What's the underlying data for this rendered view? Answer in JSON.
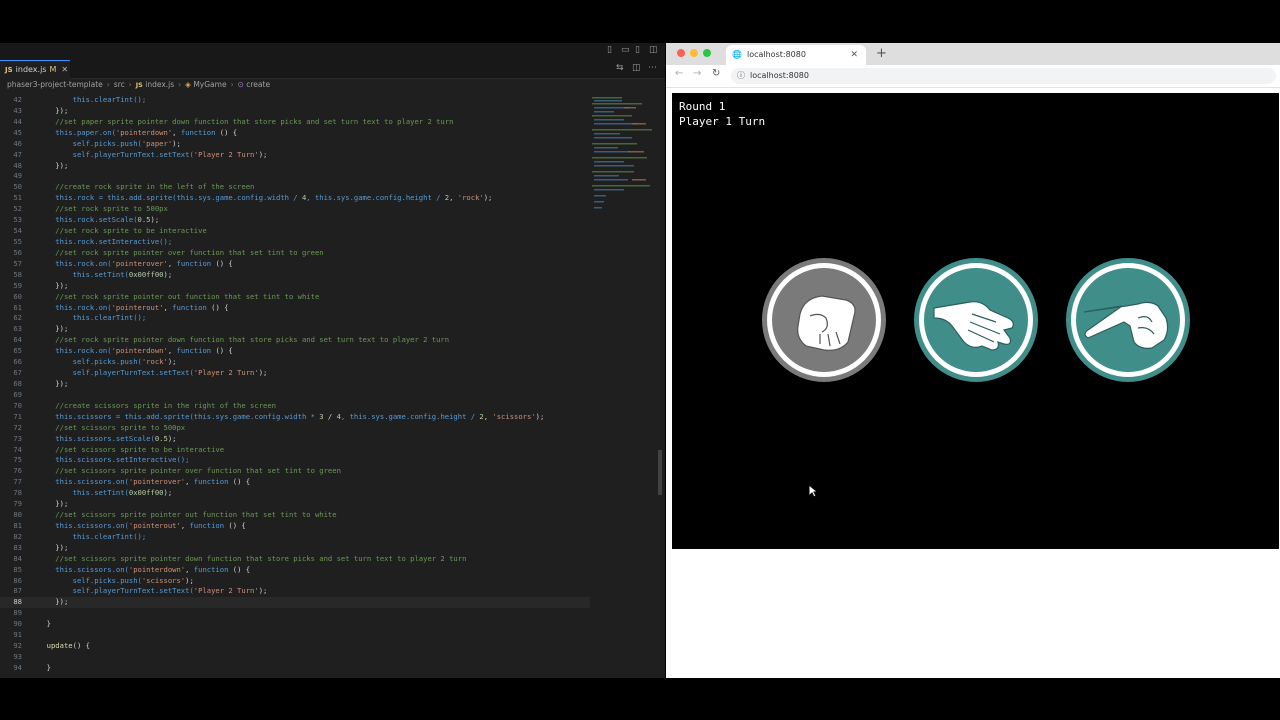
{
  "editor": {
    "tab": {
      "lang": "JS",
      "name": "index.js",
      "status": "M"
    },
    "breadcrumbs": [
      "phaser3-project-template",
      "src",
      "JS",
      "index.js",
      "MyGame",
      "create"
    ],
    "lines": [
      {
        "n": "42",
        "segs": [
          {
            "t": "        this.clearTint();",
            "c": "k"
          }
        ]
      },
      {
        "n": "43",
        "segs": [
          {
            "t": "    });",
            "c": "p"
          }
        ]
      },
      {
        "n": "44",
        "segs": [
          {
            "t": "    //set paper sprite pointer down function that store picks and set turn text to player 2 turn",
            "c": "c"
          }
        ]
      },
      {
        "n": "45",
        "segs": [
          {
            "t": "    this.paper.on(",
            "c": "k"
          },
          {
            "t": "'pointerdown'",
            "c": "s"
          },
          {
            "t": ", ",
            "c": "p"
          },
          {
            "t": "function",
            "c": "k"
          },
          {
            "t": " () {",
            "c": "p"
          }
        ]
      },
      {
        "n": "46",
        "segs": [
          {
            "t": "        self.picks.push(",
            "c": "k"
          },
          {
            "t": "'paper'",
            "c": "s"
          },
          {
            "t": ");",
            "c": "p"
          }
        ]
      },
      {
        "n": "47",
        "segs": [
          {
            "t": "        self.playerTurnText.setText(",
            "c": "k"
          },
          {
            "t": "'Player 2 Turn'",
            "c": "s"
          },
          {
            "t": ");",
            "c": "p"
          }
        ]
      },
      {
        "n": "48",
        "segs": [
          {
            "t": "    });",
            "c": "p"
          }
        ]
      },
      {
        "n": "49",
        "segs": []
      },
      {
        "n": "50",
        "segs": [
          {
            "t": "    //create rock sprite in the left of the screen",
            "c": "c"
          }
        ]
      },
      {
        "n": "51",
        "segs": [
          {
            "t": "    this.rock = this.add.sprite(this.sys.game.config.width / ",
            "c": "k"
          },
          {
            "t": "4",
            "c": "n"
          },
          {
            "t": ", this.sys.game.config.height / ",
            "c": "k"
          },
          {
            "t": "2",
            "c": "n"
          },
          {
            "t": ", ",
            "c": "p"
          },
          {
            "t": "'rock'",
            "c": "s"
          },
          {
            "t": ");",
            "c": "p"
          }
        ]
      },
      {
        "n": "52",
        "segs": [
          {
            "t": "    //set rock sprite to 500px",
            "c": "c"
          }
        ]
      },
      {
        "n": "53",
        "segs": [
          {
            "t": "    this.rock.setScale(",
            "c": "k"
          },
          {
            "t": "0.5",
            "c": "n"
          },
          {
            "t": ");",
            "c": "p"
          }
        ]
      },
      {
        "n": "54",
        "segs": [
          {
            "t": "    //set rock sprite to be interactive",
            "c": "c"
          }
        ]
      },
      {
        "n": "55",
        "segs": [
          {
            "t": "    this.rock.setInteractive();",
            "c": "k"
          }
        ]
      },
      {
        "n": "56",
        "segs": [
          {
            "t": "    //set rock sprite pointer over function that set tint to green",
            "c": "c"
          }
        ]
      },
      {
        "n": "57",
        "segs": [
          {
            "t": "    this.rock.on(",
            "c": "k"
          },
          {
            "t": "'pointerover'",
            "c": "s"
          },
          {
            "t": ", ",
            "c": "p"
          },
          {
            "t": "function",
            "c": "k"
          },
          {
            "t": " () {",
            "c": "p"
          }
        ]
      },
      {
        "n": "58",
        "segs": [
          {
            "t": "        this.setTint(",
            "c": "k"
          },
          {
            "t": "0x00ff00",
            "c": "n"
          },
          {
            "t": ");",
            "c": "p"
          }
        ]
      },
      {
        "n": "59",
        "segs": [
          {
            "t": "    });",
            "c": "p"
          }
        ]
      },
      {
        "n": "60",
        "segs": [
          {
            "t": "    //set rock sprite pointer out function that set tint to white",
            "c": "c"
          }
        ]
      },
      {
        "n": "61",
        "segs": [
          {
            "t": "    this.rock.on(",
            "c": "k"
          },
          {
            "t": "'pointerout'",
            "c": "s"
          },
          {
            "t": ", ",
            "c": "p"
          },
          {
            "t": "function",
            "c": "k"
          },
          {
            "t": " () {",
            "c": "p"
          }
        ]
      },
      {
        "n": "62",
        "segs": [
          {
            "t": "        this.clearTint();",
            "c": "k"
          }
        ]
      },
      {
        "n": "63",
        "segs": [
          {
            "t": "    });",
            "c": "p"
          }
        ]
      },
      {
        "n": "64",
        "segs": [
          {
            "t": "    //set rock sprite pointer down function that store picks and set turn text to player 2 turn",
            "c": "c"
          }
        ]
      },
      {
        "n": "65",
        "segs": [
          {
            "t": "    this.rock.on(",
            "c": "k"
          },
          {
            "t": "'pointerdown'",
            "c": "s"
          },
          {
            "t": ", ",
            "c": "p"
          },
          {
            "t": "function",
            "c": "k"
          },
          {
            "t": " () {",
            "c": "p"
          }
        ]
      },
      {
        "n": "66",
        "segs": [
          {
            "t": "        self.picks.push(",
            "c": "k"
          },
          {
            "t": "'rock'",
            "c": "s"
          },
          {
            "t": ");",
            "c": "p"
          }
        ]
      },
      {
        "n": "67",
        "segs": [
          {
            "t": "        self.playerTurnText.setText(",
            "c": "k"
          },
          {
            "t": "'Player 2 Turn'",
            "c": "s"
          },
          {
            "t": ");",
            "c": "p"
          }
        ]
      },
      {
        "n": "68",
        "segs": [
          {
            "t": "    });",
            "c": "p"
          }
        ]
      },
      {
        "n": "69",
        "segs": []
      },
      {
        "n": "70",
        "segs": [
          {
            "t": "    //create scissors sprite in the right of the screen",
            "c": "c"
          }
        ]
      },
      {
        "n": "71",
        "segs": [
          {
            "t": "    this.scissors = this.add.sprite(this.sys.game.config.width * ",
            "c": "k"
          },
          {
            "t": "3",
            "c": "n"
          },
          {
            "t": " / ",
            "c": "p"
          },
          {
            "t": "4",
            "c": "n"
          },
          {
            "t": ", this.sys.game.config.height / ",
            "c": "k"
          },
          {
            "t": "2",
            "c": "n"
          },
          {
            "t": ", ",
            "c": "p"
          },
          {
            "t": "'scissors'",
            "c": "s"
          },
          {
            "t": ");",
            "c": "p"
          }
        ]
      },
      {
        "n": "72",
        "segs": [
          {
            "t": "    //set scissors sprite to 500px",
            "c": "c"
          }
        ]
      },
      {
        "n": "73",
        "segs": [
          {
            "t": "    this.scissors.setScale(",
            "c": "k"
          },
          {
            "t": "0.5",
            "c": "n"
          },
          {
            "t": ");",
            "c": "p"
          }
        ]
      },
      {
        "n": "74",
        "segs": [
          {
            "t": "    //set scissors sprite to be interactive",
            "c": "c"
          }
        ]
      },
      {
        "n": "75",
        "segs": [
          {
            "t": "    this.scissors.setInteractive();",
            "c": "k"
          }
        ]
      },
      {
        "n": "76",
        "segs": [
          {
            "t": "    //set scissors sprite pointer over function that set tint to green",
            "c": "c"
          }
        ]
      },
      {
        "n": "77",
        "segs": [
          {
            "t": "    this.scissors.on(",
            "c": "k"
          },
          {
            "t": "'pointerover'",
            "c": "s"
          },
          {
            "t": ", ",
            "c": "p"
          },
          {
            "t": "function",
            "c": "k"
          },
          {
            "t": " () {",
            "c": "p"
          }
        ]
      },
      {
        "n": "78",
        "segs": [
          {
            "t": "        this.setTint(",
            "c": "k"
          },
          {
            "t": "0x00ff00",
            "c": "n"
          },
          {
            "t": ");",
            "c": "p"
          }
        ]
      },
      {
        "n": "79",
        "segs": [
          {
            "t": "    });",
            "c": "p"
          }
        ]
      },
      {
        "n": "80",
        "segs": [
          {
            "t": "    //set scissors sprite pointer out function that set tint to white",
            "c": "c"
          }
        ]
      },
      {
        "n": "81",
        "segs": [
          {
            "t": "    this.scissors.on(",
            "c": "k"
          },
          {
            "t": "'pointerout'",
            "c": "s"
          },
          {
            "t": ", ",
            "c": "p"
          },
          {
            "t": "function",
            "c": "k"
          },
          {
            "t": " () {",
            "c": "p"
          }
        ]
      },
      {
        "n": "82",
        "segs": [
          {
            "t": "        this.clearTint();",
            "c": "k"
          }
        ]
      },
      {
        "n": "83",
        "segs": [
          {
            "t": "    });",
            "c": "p"
          }
        ]
      },
      {
        "n": "84",
        "segs": [
          {
            "t": "    //set scissors sprite pointer down function that store picks and set turn text to player 2 turn",
            "c": "c"
          }
        ]
      },
      {
        "n": "85",
        "segs": [
          {
            "t": "    this.scissors.on(",
            "c": "k"
          },
          {
            "t": "'pointerdown'",
            "c": "s"
          },
          {
            "t": ", ",
            "c": "p"
          },
          {
            "t": "function",
            "c": "k"
          },
          {
            "t": " () {",
            "c": "p"
          }
        ]
      },
      {
        "n": "86",
        "segs": [
          {
            "t": "        self.picks.push(",
            "c": "k"
          },
          {
            "t": "'scissors'",
            "c": "s"
          },
          {
            "t": ");",
            "c": "p"
          }
        ]
      },
      {
        "n": "87",
        "segs": [
          {
            "t": "        self.playerTurnText.setText(",
            "c": "k"
          },
          {
            "t": "'Player 2 Turn'",
            "c": "s"
          },
          {
            "t": ");",
            "c": "p"
          }
        ]
      },
      {
        "n": "88",
        "segs": [
          {
            "t": "    });",
            "c": "p"
          }
        ],
        "active": true
      },
      {
        "n": "89",
        "segs": []
      },
      {
        "n": "90",
        "segs": [
          {
            "t": "  }",
            "c": "p"
          }
        ]
      },
      {
        "n": "91",
        "segs": []
      },
      {
        "n": "92",
        "segs": [
          {
            "t": "  update",
            "c": "f"
          },
          {
            "t": "() {",
            "c": "p"
          }
        ]
      },
      {
        "n": "93",
        "segs": []
      },
      {
        "n": "94",
        "segs": [
          {
            "t": "  }",
            "c": "p"
          }
        ]
      }
    ]
  },
  "browser": {
    "tab_title": "localhost:8080",
    "url": "localhost:8080",
    "game": {
      "round_text": "Round 1",
      "turn_text": "Player 1 Turn",
      "sprites": [
        {
          "name": "rock",
          "tint": "gray"
        },
        {
          "name": "paper",
          "tint": "teal"
        },
        {
          "name": "scissors",
          "tint": "teal"
        }
      ]
    }
  },
  "colors": {
    "editor_bg": "#1f1f1f",
    "teal": "#3f8e89",
    "gray_tint": "#7a7a7a"
  }
}
